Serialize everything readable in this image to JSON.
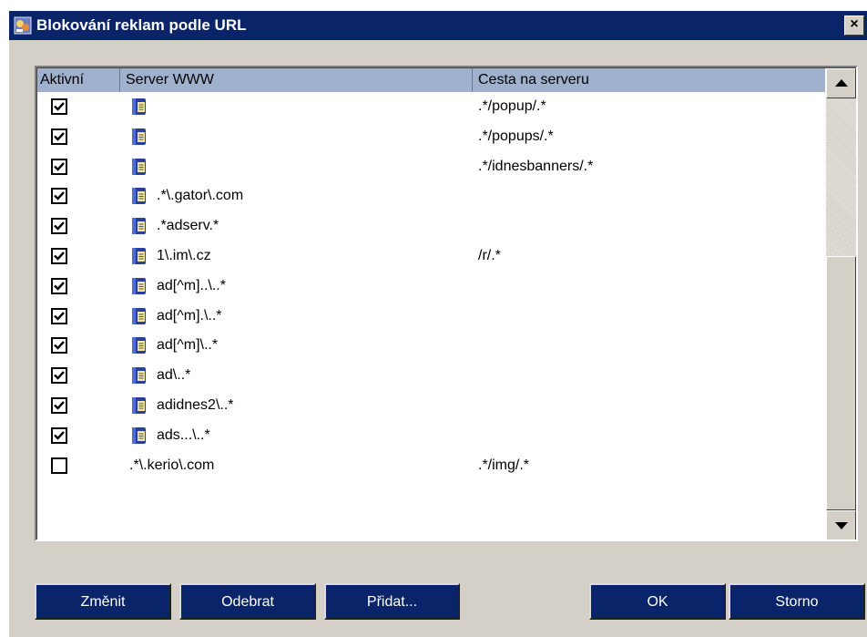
{
  "window": {
    "title": "Blokování reklam podle URL",
    "close_label": "×",
    "icon": "shield-ad-blocker-icon"
  },
  "table": {
    "columns": [
      "Aktivní",
      "Server WWW",
      "Cesta na serveru"
    ],
    "rows": [
      {
        "active": true,
        "icon": "server-icon",
        "server": "",
        "path": ".*/popup/.*"
      },
      {
        "active": true,
        "icon": "server-icon",
        "server": "",
        "path": ".*/popups/.*"
      },
      {
        "active": true,
        "icon": "server-icon",
        "server": "",
        "path": ".*/idnesbanners/.*"
      },
      {
        "active": true,
        "icon": "server-icon",
        "server": ".*\\.gator\\.com",
        "path": ""
      },
      {
        "active": true,
        "icon": "server-icon",
        "server": ".*adserv.*",
        "path": ""
      },
      {
        "active": true,
        "icon": "server-icon",
        "server": "1\\.im\\.cz",
        "path": "/r/.*"
      },
      {
        "active": true,
        "icon": "server-icon",
        "server": "ad[^m]..\\..*",
        "path": ""
      },
      {
        "active": true,
        "icon": "server-icon",
        "server": "ad[^m].\\..*",
        "path": ""
      },
      {
        "active": true,
        "icon": "server-icon",
        "server": "ad[^m]\\..*",
        "path": ""
      },
      {
        "active": true,
        "icon": "server-icon",
        "server": "ad\\..*",
        "path": ""
      },
      {
        "active": true,
        "icon": "server-icon",
        "server": "adidnes2\\..*",
        "path": ""
      },
      {
        "active": true,
        "icon": "server-icon",
        "server": "ads...\\..*",
        "path": ""
      },
      {
        "active": false,
        "icon": "",
        "server": ".*\\.kerio\\.com",
        "path": ".*/img/.*"
      }
    ]
  },
  "buttons": {
    "change": {
      "label": "Změnit"
    },
    "remove": {
      "label": "Odebrat"
    },
    "add": {
      "label": "Přidat..."
    },
    "ok": {
      "label": "OK"
    },
    "cancel": {
      "label": "Storno"
    }
  },
  "colors": {
    "titlebar": "#0a246a",
    "header": "#9fb1cd",
    "face": "#d4d0c8"
  }
}
